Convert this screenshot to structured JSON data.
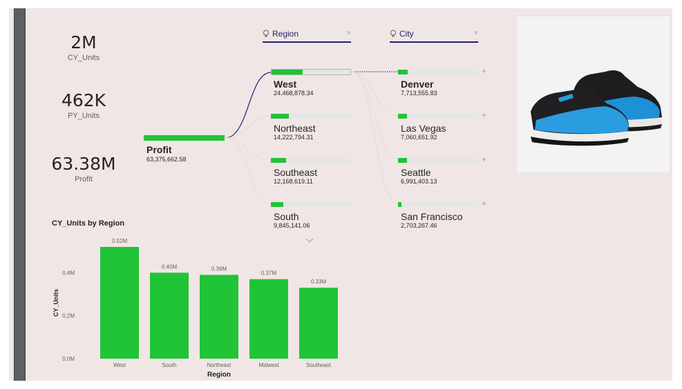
{
  "kpis": [
    {
      "value": "2M",
      "label": "CY_Units"
    },
    {
      "value": "462K",
      "label": "PY_Units"
    },
    {
      "value": "63.38M",
      "label": "Profit"
    }
  ],
  "slicers": {
    "region": {
      "title": "Region",
      "close": "×"
    },
    "city": {
      "title": "City",
      "close": "×"
    }
  },
  "tree": {
    "root": {
      "name": "Profit",
      "value": "63,375,662.58"
    },
    "regions": [
      {
        "name": "West",
        "value": "24,468,878.34",
        "fraction": 0.386
      },
      {
        "name": "Northeast",
        "value": "14,222,794.31",
        "fraction": 0.224
      },
      {
        "name": "Southeast",
        "value": "12,168,619.11",
        "fraction": 0.192
      },
      {
        "name": "South",
        "value": "9,845,141.06",
        "fraction": 0.155
      }
    ],
    "cities": [
      {
        "name": "Denver",
        "value": "7,713,555.83",
        "fraction": 0.122
      },
      {
        "name": "Las Vegas",
        "value": "7,060,651.92",
        "fraction": 0.111
      },
      {
        "name": "Seattle",
        "value": "6,991,403.13",
        "fraction": 0.11
      },
      {
        "name": "San Francisco",
        "value": "2,703,267.46",
        "fraction": 0.043
      }
    ],
    "plus": "+"
  },
  "chart_data": {
    "type": "bar",
    "title": "CY_Units by Region",
    "xlabel": "Region",
    "ylabel": "CY_Units",
    "categories": [
      "West",
      "South",
      "Northeast",
      "Midwest",
      "Southeast"
    ],
    "values": [
      0.52,
      0.4,
      0.39,
      0.37,
      0.33
    ],
    "data_labels": [
      "0.52M",
      "0.40M",
      "0.39M",
      "0.37M",
      "0.33M"
    ],
    "yticks": [
      "0.0M",
      "0.2M",
      "0.4M"
    ],
    "ylim": [
      0,
      0.52
    ],
    "bar_color": "#20c437",
    "grid": false
  },
  "colors": {
    "accent": "#20c437",
    "slicer_underline": "#1f1f6e",
    "background": "#f0e6e6"
  },
  "icons": {
    "bulb": "lightbulb-icon",
    "chevron": "chevron-down-icon",
    "image": "sneaker-image"
  }
}
